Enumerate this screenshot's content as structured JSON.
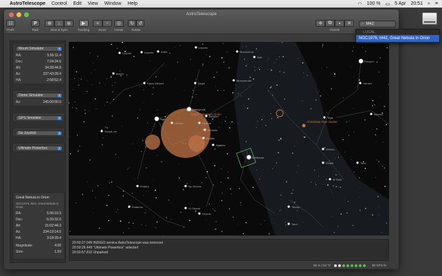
{
  "menubar": {
    "app": "AstroTelescope",
    "menus": [
      "Control",
      "Edit",
      "View",
      "Window",
      "Help"
    ],
    "battery": "100 %",
    "date": "5 Apr",
    "time": "20:51"
  },
  "window": {
    "title": "AstroTelescope"
  },
  "toolbar": {
    "prefs": "Prefs",
    "park": "Park",
    "slew_sync": "Slew & Sync",
    "tracking": "Tracking",
    "zoom": "Zoom",
    "center": "Center",
    "rotate": "Rotate",
    "panels": "Panels"
  },
  "search": {
    "value": "M42"
  },
  "dropdown": {
    "header": "LOCAL",
    "result": "NGC1976, M42, Great Nebula in Orion"
  },
  "mount": {
    "select": "Mount Simulator",
    "rows": [
      {
        "k": "RA:",
        "v": "5:56:11.4"
      },
      {
        "k": "Dec:",
        "v": "7:24:24.5"
      },
      {
        "k": "Alt:",
        "v": "34:28:44.8"
      },
      {
        "k": "Az:",
        "v": "237:43:28.4"
      },
      {
        "k": "HA:",
        "v": "2:58:52.4"
      }
    ]
  },
  "dome": {
    "select": "Dome Simulator",
    "rows": [
      {
        "k": "Az:",
        "v": "245:00:00.0"
      }
    ]
  },
  "gps": {
    "select": "GPS Simulator"
  },
  "joystick": {
    "select": "No Joystick"
  },
  "power": {
    "select": "Ultimate Powerbox"
  },
  "object": {
    "title": "Great Nebula in Orion",
    "ids": "NGC1976, M42, Great Nebula in Orion",
    "rows": [
      {
        "k": "RA:",
        "v": "5:36:19.3"
      },
      {
        "k": "Dec:",
        "v": "-5:26:32.6"
      },
      {
        "k": "Alt:",
        "v": "21:02:44.3"
      },
      {
        "k": "Az:",
        "v": "234:19:14.5"
      },
      {
        "k": "HA:",
        "v": "3:18:39.4"
      },
      {
        "k": "Magnitude:",
        "v": "4.00"
      },
      {
        "k": "Size:",
        "v": "1.50"
      }
    ]
  },
  "sky_labels": {
    "orion_nebula": "Great Nebula in Orion",
    "xmas_tree": "Christmas Tree cluster",
    "stars": [
      "Leporis",
      "Aneb",
      "Leporis",
      "Monoceros",
      "Betelgeuse",
      "Procyon",
      "Rigel",
      "Orionis",
      "Saiph",
      "Bellatrix",
      "Alnilam",
      "Mintaka",
      "Alnitak",
      "Eridani",
      "Gemini",
      "Alhena",
      "Tejat",
      "Taurus",
      "Aldebaran",
      "Elnath",
      "Tauri",
      "Leporis",
      "Arneb",
      "Nair",
      "Monocerotis",
      "Canis Minoris",
      "Scepti-um",
      "Hyades",
      "Alhena",
      "Nu Orionis",
      "Orionis",
      "Eridanus",
      "Xi Orionis",
      "Tauri",
      "Al Tauri"
    ]
  },
  "log": {
    "lines": [
      "20:50:27.049 INDIGO service AstroTelescope was removed",
      "20:50:28.449 \"Ultimate Powerbox\" selected",
      "20:50:57.810 Unparked"
    ]
  },
  "status": {
    "left": "55 % | 24 °C",
    "right": "30 GPS fix"
  },
  "colors": {
    "accent": "#3a84e0",
    "nebula": "#c8784a",
    "selection": "#2d64c6"
  }
}
